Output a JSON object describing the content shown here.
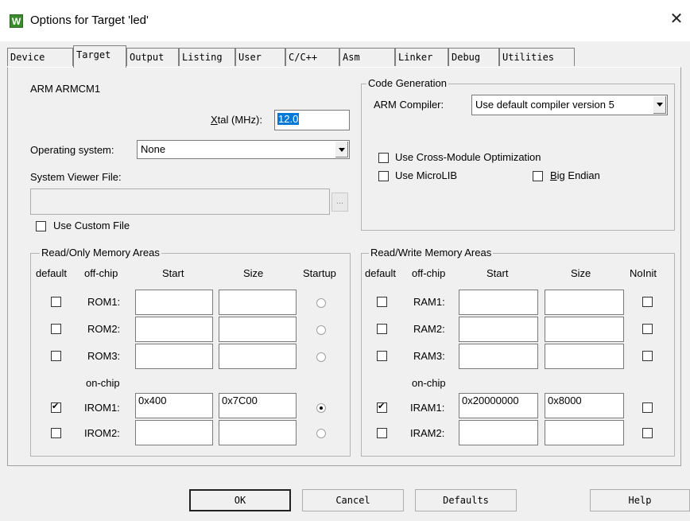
{
  "window": {
    "title": "Options for Target 'led'",
    "app_icon_letter": "W",
    "close_glyph": "✕"
  },
  "tabs": [
    {
      "label": "Device"
    },
    {
      "label": "Target"
    },
    {
      "label": "Output"
    },
    {
      "label": "Listing"
    },
    {
      "label": "User"
    },
    {
      "label": "C/C++"
    },
    {
      "label": "Asm"
    },
    {
      "label": "Linker"
    },
    {
      "label": "Debug"
    },
    {
      "label": "Utilities"
    }
  ],
  "active_tab": "Target",
  "target": {
    "device_name": "ARM ARMCM1",
    "xtal_label": "Xtal (MHz):",
    "xtal_value": "12.0",
    "os_label": "Operating system:",
    "os_value": "None",
    "svf_label": "System Viewer File:",
    "svf_value": "",
    "browse_label": "...",
    "use_custom_file_label": "Use Custom File",
    "use_custom_file_checked": false
  },
  "code_gen": {
    "group_title": "Code Generation",
    "compiler_label": "ARM Compiler:",
    "compiler_value": "Use default compiler version 5",
    "cross_module_label": "Use Cross-Module Optimization",
    "cross_module_checked": false,
    "microlib_label": "Use MicroLIB",
    "microlib_checked": false,
    "big_endian_label": "Big Endian",
    "big_endian_checked": false
  },
  "rom": {
    "group_title": "Read/Only Memory Areas",
    "headers": {
      "default": "default",
      "offchip": "off-chip",
      "start": "Start",
      "size": "Size",
      "startup": "Startup"
    },
    "onchip_label": "on-chip",
    "rows": [
      {
        "name": "ROM1:",
        "default": false,
        "start": "",
        "size": "",
        "startup": false
      },
      {
        "name": "ROM2:",
        "default": false,
        "start": "",
        "size": "",
        "startup": false
      },
      {
        "name": "ROM3:",
        "default": false,
        "start": "",
        "size": "",
        "startup": false
      },
      {
        "name": "IROM1:",
        "default": true,
        "start": "0x400",
        "size": "0x7C00",
        "startup": true
      },
      {
        "name": "IROM2:",
        "default": false,
        "start": "",
        "size": "",
        "startup": false
      }
    ]
  },
  "ram": {
    "group_title": "Read/Write Memory Areas",
    "headers": {
      "default": "default",
      "offchip": "off-chip",
      "start": "Start",
      "size": "Size",
      "noinit": "NoInit"
    },
    "onchip_label": "on-chip",
    "rows": [
      {
        "name": "RAM1:",
        "default": false,
        "start": "",
        "size": "",
        "noinit": false
      },
      {
        "name": "RAM2:",
        "default": false,
        "start": "",
        "size": "",
        "noinit": false
      },
      {
        "name": "RAM3:",
        "default": false,
        "start": "",
        "size": "",
        "noinit": false
      },
      {
        "name": "IRAM1:",
        "default": true,
        "start": "0x20000000",
        "size": "0x8000",
        "noinit": false
      },
      {
        "name": "IRAM2:",
        "default": false,
        "start": "",
        "size": "",
        "noinit": false
      }
    ]
  },
  "buttons": {
    "ok": "OK",
    "cancel": "Cancel",
    "defaults": "Defaults",
    "help": "Help"
  }
}
